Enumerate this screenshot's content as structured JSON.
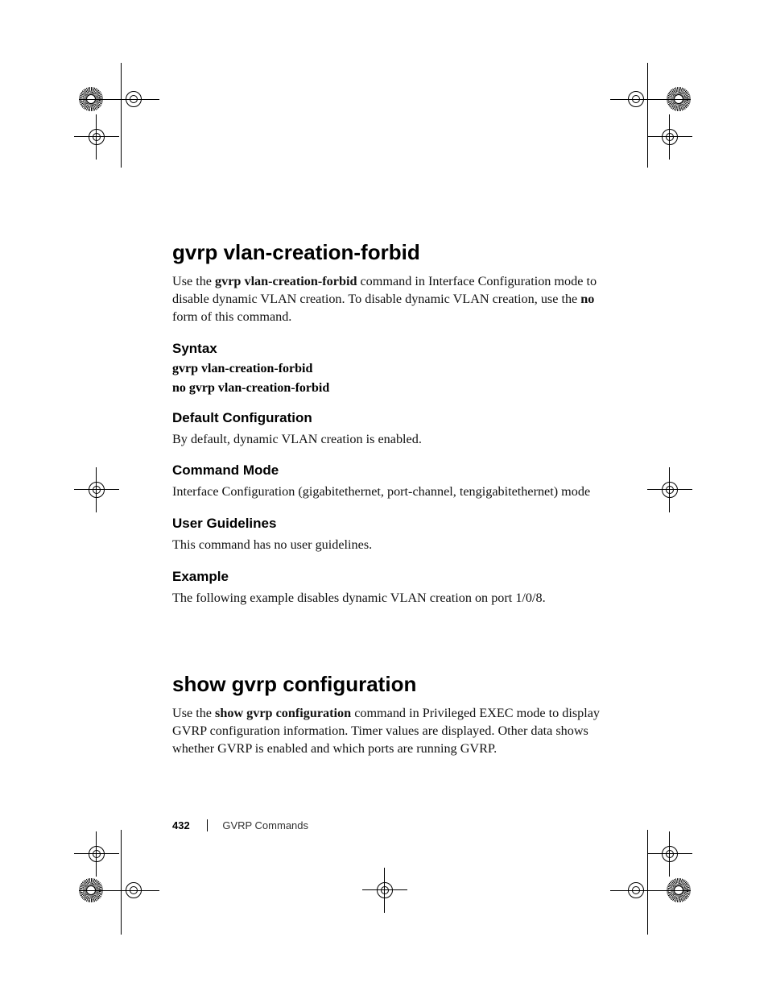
{
  "section1": {
    "title": "gvrp vlan-creation-forbid",
    "intro_pre": "Use the ",
    "intro_bold1": "gvrp vlan-creation-forbid",
    "intro_mid": " command in Interface Configuration mode to disable dynamic VLAN creation. To disable dynamic VLAN creation, use the ",
    "intro_bold2": "no",
    "intro_post": " form of this command.",
    "syntax_heading": "Syntax",
    "syntax_line1": "gvrp vlan-creation-forbid",
    "syntax_line2": "no gvrp vlan-creation-forbid",
    "default_heading": "Default Configuration",
    "default_text": "By default, dynamic VLAN creation is enabled.",
    "mode_heading": "Command Mode",
    "mode_text": "Interface Configuration (gigabitethernet, port-channel, tengigabitethernet) mode",
    "guidelines_heading": "User Guidelines",
    "guidelines_text": "This command has no user guidelines.",
    "example_heading": "Example",
    "example_text": "The following example disables dynamic VLAN creation on port 1/0/8."
  },
  "section2": {
    "title": "show gvrp configuration",
    "intro_pre": "Use the ",
    "intro_bold": "show gvrp configuration",
    "intro_post": " command in Privileged EXEC mode to display GVRP configuration information. Timer values are displayed. Other data shows whether GVRP is enabled and which ports are running GVRP."
  },
  "footer": {
    "page_number": "432",
    "section_name": "GVRP Commands"
  }
}
